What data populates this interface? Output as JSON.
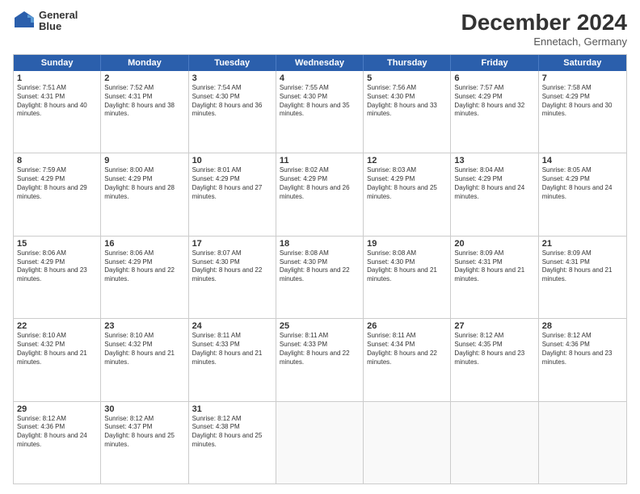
{
  "header": {
    "logo_line1": "General",
    "logo_line2": "Blue",
    "month": "December 2024",
    "location": "Ennetach, Germany"
  },
  "days": [
    "Sunday",
    "Monday",
    "Tuesday",
    "Wednesday",
    "Thursday",
    "Friday",
    "Saturday"
  ],
  "weeks": [
    [
      {
        "day": "1",
        "rise": "Sunrise: 7:51 AM",
        "set": "Sunset: 4:31 PM",
        "daylight": "Daylight: 8 hours and 40 minutes."
      },
      {
        "day": "2",
        "rise": "Sunrise: 7:52 AM",
        "set": "Sunset: 4:31 PM",
        "daylight": "Daylight: 8 hours and 38 minutes."
      },
      {
        "day": "3",
        "rise": "Sunrise: 7:54 AM",
        "set": "Sunset: 4:30 PM",
        "daylight": "Daylight: 8 hours and 36 minutes."
      },
      {
        "day": "4",
        "rise": "Sunrise: 7:55 AM",
        "set": "Sunset: 4:30 PM",
        "daylight": "Daylight: 8 hours and 35 minutes."
      },
      {
        "day": "5",
        "rise": "Sunrise: 7:56 AM",
        "set": "Sunset: 4:30 PM",
        "daylight": "Daylight: 8 hours and 33 minutes."
      },
      {
        "day": "6",
        "rise": "Sunrise: 7:57 AM",
        "set": "Sunset: 4:29 PM",
        "daylight": "Daylight: 8 hours and 32 minutes."
      },
      {
        "day": "7",
        "rise": "Sunrise: 7:58 AM",
        "set": "Sunset: 4:29 PM",
        "daylight": "Daylight: 8 hours and 30 minutes."
      }
    ],
    [
      {
        "day": "8",
        "rise": "Sunrise: 7:59 AM",
        "set": "Sunset: 4:29 PM",
        "daylight": "Daylight: 8 hours and 29 minutes."
      },
      {
        "day": "9",
        "rise": "Sunrise: 8:00 AM",
        "set": "Sunset: 4:29 PM",
        "daylight": "Daylight: 8 hours and 28 minutes."
      },
      {
        "day": "10",
        "rise": "Sunrise: 8:01 AM",
        "set": "Sunset: 4:29 PM",
        "daylight": "Daylight: 8 hours and 27 minutes."
      },
      {
        "day": "11",
        "rise": "Sunrise: 8:02 AM",
        "set": "Sunset: 4:29 PM",
        "daylight": "Daylight: 8 hours and 26 minutes."
      },
      {
        "day": "12",
        "rise": "Sunrise: 8:03 AM",
        "set": "Sunset: 4:29 PM",
        "daylight": "Daylight: 8 hours and 25 minutes."
      },
      {
        "day": "13",
        "rise": "Sunrise: 8:04 AM",
        "set": "Sunset: 4:29 PM",
        "daylight": "Daylight: 8 hours and 24 minutes."
      },
      {
        "day": "14",
        "rise": "Sunrise: 8:05 AM",
        "set": "Sunset: 4:29 PM",
        "daylight": "Daylight: 8 hours and 24 minutes."
      }
    ],
    [
      {
        "day": "15",
        "rise": "Sunrise: 8:06 AM",
        "set": "Sunset: 4:29 PM",
        "daylight": "Daylight: 8 hours and 23 minutes."
      },
      {
        "day": "16",
        "rise": "Sunrise: 8:06 AM",
        "set": "Sunset: 4:29 PM",
        "daylight": "Daylight: 8 hours and 22 minutes."
      },
      {
        "day": "17",
        "rise": "Sunrise: 8:07 AM",
        "set": "Sunset: 4:30 PM",
        "daylight": "Daylight: 8 hours and 22 minutes."
      },
      {
        "day": "18",
        "rise": "Sunrise: 8:08 AM",
        "set": "Sunset: 4:30 PM",
        "daylight": "Daylight: 8 hours and 22 minutes."
      },
      {
        "day": "19",
        "rise": "Sunrise: 8:08 AM",
        "set": "Sunset: 4:30 PM",
        "daylight": "Daylight: 8 hours and 21 minutes."
      },
      {
        "day": "20",
        "rise": "Sunrise: 8:09 AM",
        "set": "Sunset: 4:31 PM",
        "daylight": "Daylight: 8 hours and 21 minutes."
      },
      {
        "day": "21",
        "rise": "Sunrise: 8:09 AM",
        "set": "Sunset: 4:31 PM",
        "daylight": "Daylight: 8 hours and 21 minutes."
      }
    ],
    [
      {
        "day": "22",
        "rise": "Sunrise: 8:10 AM",
        "set": "Sunset: 4:32 PM",
        "daylight": "Daylight: 8 hours and 21 minutes."
      },
      {
        "day": "23",
        "rise": "Sunrise: 8:10 AM",
        "set": "Sunset: 4:32 PM",
        "daylight": "Daylight: 8 hours and 21 minutes."
      },
      {
        "day": "24",
        "rise": "Sunrise: 8:11 AM",
        "set": "Sunset: 4:33 PM",
        "daylight": "Daylight: 8 hours and 21 minutes."
      },
      {
        "day": "25",
        "rise": "Sunrise: 8:11 AM",
        "set": "Sunset: 4:33 PM",
        "daylight": "Daylight: 8 hours and 22 minutes."
      },
      {
        "day": "26",
        "rise": "Sunrise: 8:11 AM",
        "set": "Sunset: 4:34 PM",
        "daylight": "Daylight: 8 hours and 22 minutes."
      },
      {
        "day": "27",
        "rise": "Sunrise: 8:12 AM",
        "set": "Sunset: 4:35 PM",
        "daylight": "Daylight: 8 hours and 23 minutes."
      },
      {
        "day": "28",
        "rise": "Sunrise: 8:12 AM",
        "set": "Sunset: 4:36 PM",
        "daylight": "Daylight: 8 hours and 23 minutes."
      }
    ],
    [
      {
        "day": "29",
        "rise": "Sunrise: 8:12 AM",
        "set": "Sunset: 4:36 PM",
        "daylight": "Daylight: 8 hours and 24 minutes."
      },
      {
        "day": "30",
        "rise": "Sunrise: 8:12 AM",
        "set": "Sunset: 4:37 PM",
        "daylight": "Daylight: 8 hours and 25 minutes."
      },
      {
        "day": "31",
        "rise": "Sunrise: 8:12 AM",
        "set": "Sunset: 4:38 PM",
        "daylight": "Daylight: 8 hours and 25 minutes."
      },
      null,
      null,
      null,
      null
    ]
  ]
}
